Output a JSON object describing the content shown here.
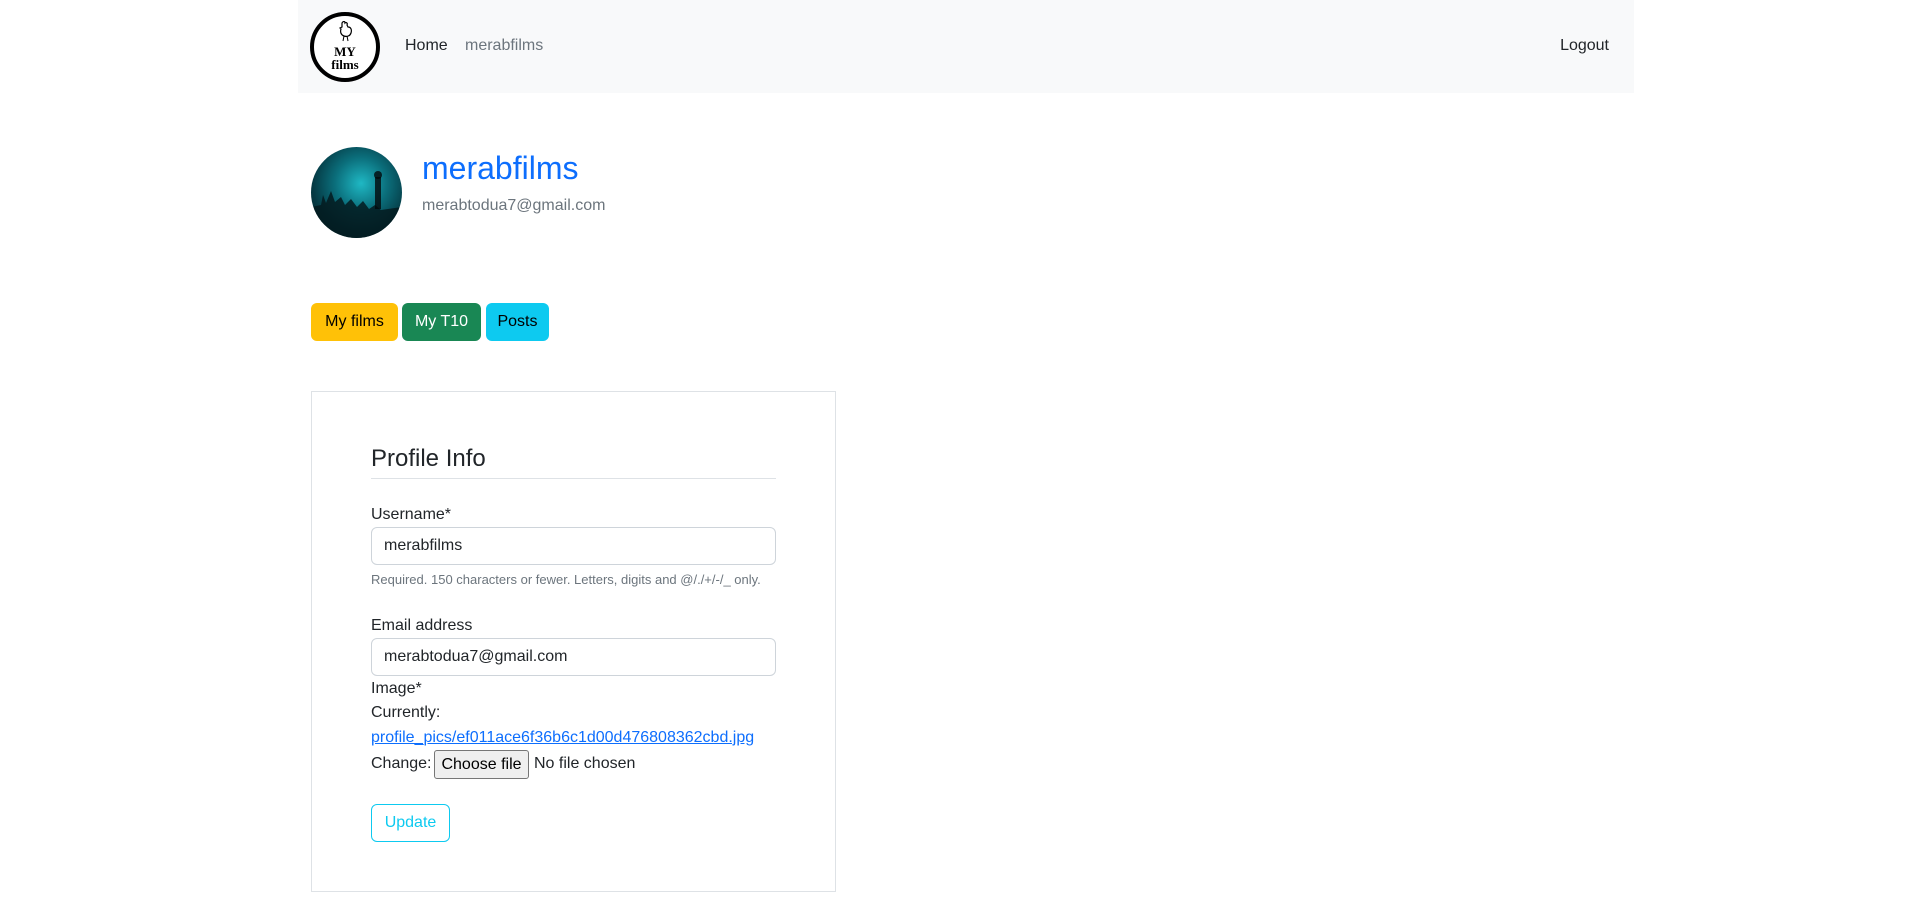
{
  "nav": {
    "logo_line1": "MY",
    "logo_line2": "films",
    "home": "Home",
    "user": "merabfilms",
    "logout": "Logout"
  },
  "profile": {
    "name": "merabfilms",
    "email": "merabtodua7@gmail.com"
  },
  "buttons": {
    "my_films": "My films",
    "my_t10": "My T10",
    "posts": "Posts"
  },
  "form": {
    "legend": "Profile Info",
    "username_label": "Username*",
    "username_value": "merabfilms",
    "username_help": "Required. 150 characters or fewer. Letters, digits and @/./+/-/_ only.",
    "email_label": "Email address",
    "email_value": "merabtodua7@gmail.com",
    "image_label": "Image*",
    "currently_label": "Currently:",
    "current_file": "profile_pics/ef011ace6f36b6c1d00d476808362cbd.jpg",
    "change_label": "Change:",
    "choose_file": "Choose file",
    "no_file": "No file chosen",
    "update": "Update"
  },
  "colors": {
    "primary": "#0d6efd",
    "warning": "#ffc107",
    "success": "#198754",
    "info": "#0dcaf0",
    "navbar_bg": "#f8f9fa"
  }
}
